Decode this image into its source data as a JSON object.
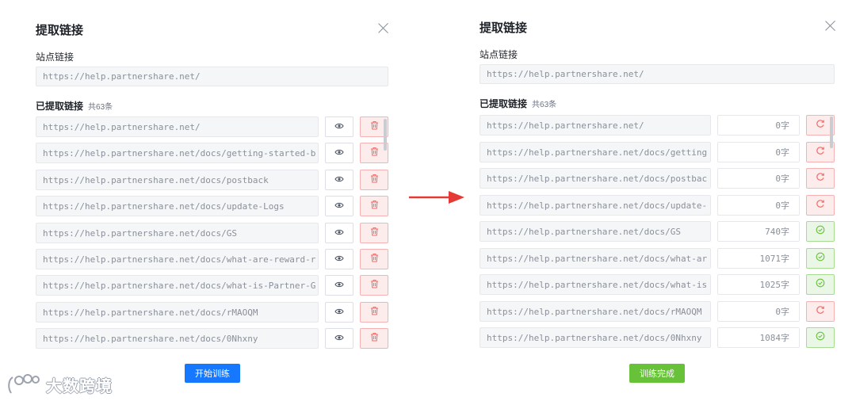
{
  "left_dialog": {
    "title": "提取链接",
    "site_link_label": "站点链接",
    "site_link_value": "https://help.partnershare.net/",
    "extracted_label": "已提取链接",
    "count_text": "共63条",
    "links": [
      "https://help.partnershare.net/",
      "https://help.partnershare.net/docs/getting-started-b",
      "https://help.partnershare.net/docs/postback",
      "https://help.partnershare.net/docs/update-Logs",
      "https://help.partnershare.net/docs/GS",
      "https://help.partnershare.net/docs/what-are-reward-r",
      "https://help.partnershare.net/docs/what-is-Partner-G",
      "https://help.partnershare.net/docs/rMAOQM",
      "https://help.partnershare.net/docs/0Nhxny"
    ],
    "action_button": "开始训练",
    "action_color": "#1677ff"
  },
  "right_dialog": {
    "title": "提取链接",
    "site_link_label": "站点链接",
    "site_link_value": "https://help.partnershare.net/",
    "extracted_label": "已提取链接",
    "count_text": "共63条",
    "links": [
      {
        "url": "https://help.partnershare.net/",
        "chars": "0字",
        "status": "retry"
      },
      {
        "url": "https://help.partnershare.net/docs/getting",
        "chars": "0字",
        "status": "retry"
      },
      {
        "url": "https://help.partnershare.net/docs/postbac",
        "chars": "0字",
        "status": "retry"
      },
      {
        "url": "https://help.partnershare.net/docs/update-",
        "chars": "0字",
        "status": "retry"
      },
      {
        "url": "https://help.partnershare.net/docs/GS",
        "chars": "740字",
        "status": "done"
      },
      {
        "url": "https://help.partnershare.net/docs/what-ar",
        "chars": "1071字",
        "status": "done"
      },
      {
        "url": "https://help.partnershare.net/docs/what-is",
        "chars": "1025字",
        "status": "done"
      },
      {
        "url": "https://help.partnershare.net/docs/rMAOQM",
        "chars": "0字",
        "status": "retry"
      },
      {
        "url": "https://help.partnershare.net/docs/0Nhxny",
        "chars": "1084字",
        "status": "done"
      }
    ],
    "action_button": "训练完成",
    "action_color": "#67c23a"
  },
  "icons": {
    "close": "close-icon",
    "view": "eye-icon",
    "delete": "trash-icon",
    "retry": "refresh-icon",
    "done": "check-circle-icon",
    "arrow": "arrow-right-icon"
  },
  "colors": {
    "arrow": "#e53935",
    "danger": "#f56c6c",
    "success": "#67c23a"
  },
  "watermark": {
    "text": "大数跨境"
  }
}
